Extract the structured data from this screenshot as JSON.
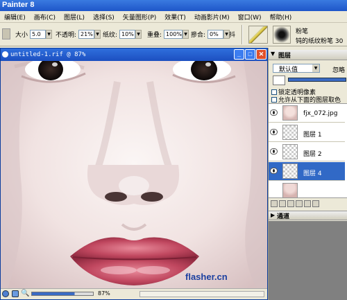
{
  "app": {
    "title": "Painter 8"
  },
  "menu": [
    "编辑(E)",
    "画布(C)",
    "图层(L)",
    "选择(S)",
    "矢量图形(P)",
    "效果(T)",
    "动画影片(M)",
    "窗口(W)",
    "帮助(H)"
  ],
  "property_bar": {
    "size_label": "大小",
    "size_value": "5.0",
    "opacity_label": "不透明:",
    "opacity_value": "21%",
    "grain_label": "纸纹:",
    "grain_value": "10%",
    "resat_label": "重叠:",
    "resat_value": "100%",
    "bleed_label": "摻合:",
    "bleed_value": "0%",
    "jitter_label": "抖",
    "brush_category": "粉笔",
    "brush_variant": "钝的纸纹粉笔 30"
  },
  "document": {
    "title": "untitled-1.rif @ 87%",
    "zoom": "87%",
    "watermark": "flasher.cn"
  },
  "layers_panel": {
    "title": "图层",
    "composite_method": "默认值",
    "opacity_short": "忽略",
    "options": [
      "锁定透明像素",
      "允许从下面的图层取色"
    ],
    "layers": [
      {
        "name": "fjx_072.jpg",
        "selected": false
      },
      {
        "name": "图层 1",
        "selected": false
      },
      {
        "name": "图层 2",
        "selected": false
      },
      {
        "name": "图层 4",
        "selected": true
      }
    ]
  },
  "channels_panel": {
    "title": "通道"
  },
  "colors": {
    "titlebar": "#1e56c9",
    "selection": "#3169c6",
    "watermark": "#1a3fa0"
  }
}
